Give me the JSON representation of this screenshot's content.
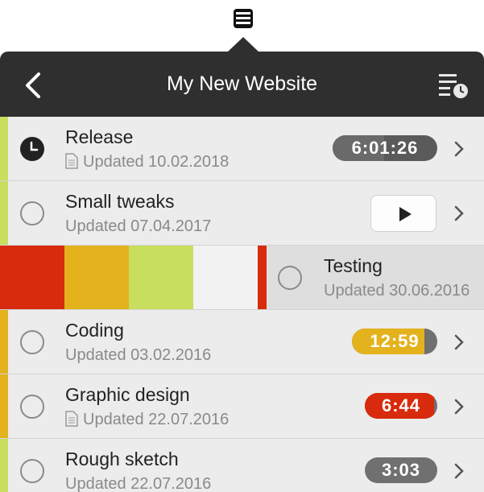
{
  "app": {
    "menubar_icon": "notebook-icon"
  },
  "header": {
    "title": "My New Website",
    "back_icon": "chevron-left-icon",
    "sort_icon": "list-clock-icon",
    "background": "#2f2f2f"
  },
  "projects": [
    {
      "name": "Release",
      "updated": "Updated 10.02.2018",
      "has_note": true,
      "status": "running",
      "timer": "6:01:26",
      "stripe_color": "#c8de5e",
      "timer_color": "#5a5a5a"
    },
    {
      "name": "Small tweaks",
      "updated": "Updated 07.04.2017",
      "has_note": false,
      "status": "idle",
      "action": "play",
      "stripe_color": "#c8de5e"
    },
    {
      "name": "Testing",
      "updated": "Updated 30.06.2016",
      "has_note": false,
      "status": "idle",
      "swiped": true,
      "stripe_color": "#d82a0c"
    },
    {
      "name": "Coding",
      "updated": "Updated 03.02.2016",
      "has_note": false,
      "status": "idle",
      "timer": "12:59",
      "stripe_color": "#e3b21d",
      "timer_color": "#e3b21d"
    },
    {
      "name": "Graphic design",
      "updated": "Updated 22.07.2016",
      "has_note": true,
      "status": "idle",
      "timer": "6:44",
      "stripe_color": "#e3b21d",
      "timer_color": "#d82a0c"
    },
    {
      "name": "Rough sketch",
      "updated": "Updated 22.07.2016",
      "has_note": false,
      "status": "idle",
      "timer": "3:03",
      "stripe_color": "#c8de5e",
      "timer_color": "#707070"
    }
  ],
  "color_options": [
    "#d82a0c",
    "#e3b21d",
    "#c8de5e",
    "#f2f2f2"
  ]
}
